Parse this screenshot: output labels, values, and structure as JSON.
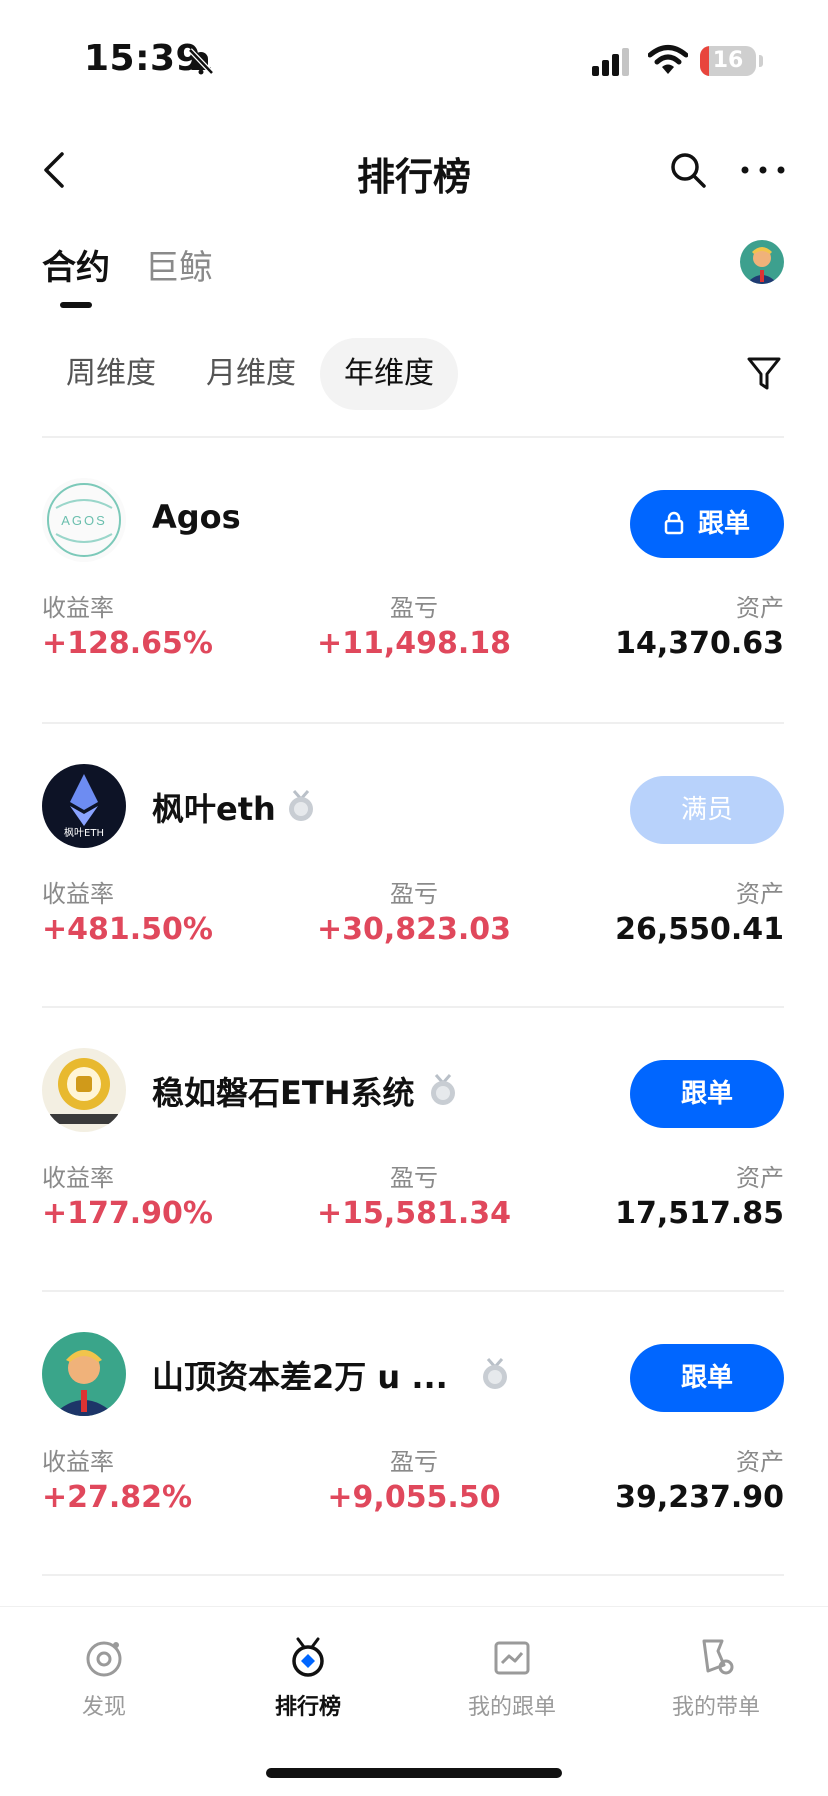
{
  "status_bar": {
    "time": "15:39",
    "battery": "16",
    "battery_level": 0.16
  },
  "header": {
    "title": "排行榜"
  },
  "main_tabs": [
    {
      "label": "合约",
      "active": true
    },
    {
      "label": "巨鲸",
      "active": false
    }
  ],
  "periods": [
    {
      "label": "周维度"
    },
    {
      "label": "月维度"
    },
    {
      "label": "年维度",
      "active": true
    }
  ],
  "metric_labels": {
    "rate": "收益率",
    "pnl": "盈亏",
    "assets": "资产"
  },
  "traders": [
    {
      "name": "Agos",
      "avatar_text": "AGOS",
      "medal": false,
      "button": "跟单",
      "button_locked": true,
      "button_state": "active",
      "rate": "+128.65%",
      "pnl": "+11,498.18",
      "assets": "14,370.63"
    },
    {
      "name": "枫叶eth",
      "avatar_text": "枫叶ETH",
      "medal": true,
      "button": "满员",
      "button_locked": false,
      "button_state": "full",
      "rate": "+481.50%",
      "pnl": "+30,823.03",
      "assets": "26,550.41"
    },
    {
      "name": "稳如磐石ETH系统",
      "avatar_text": "",
      "medal": true,
      "button": "跟单",
      "button_locked": false,
      "button_state": "active",
      "rate": "+177.90%",
      "pnl": "+15,581.34",
      "assets": "17,517.85"
    },
    {
      "name": "山顶资本差2万 u ...",
      "avatar_text": "",
      "medal": true,
      "button": "跟单",
      "button_locked": false,
      "button_state": "active",
      "rate": "+27.82%",
      "pnl": "+9,055.50",
      "assets": "39,237.90"
    }
  ],
  "tabbar": [
    {
      "label": "发现",
      "icon": "discover-icon"
    },
    {
      "label": "排行榜",
      "icon": "leaderboard-icon",
      "active": true
    },
    {
      "label": "我的跟单",
      "icon": "copy-trade-icon"
    },
    {
      "label": "我的带单",
      "icon": "lead-trade-icon"
    }
  ],
  "colors": {
    "accent": "#0066ff",
    "positive": "#e0485c",
    "muted": "#8a8a8a",
    "full_button": "#b8d2fb"
  }
}
